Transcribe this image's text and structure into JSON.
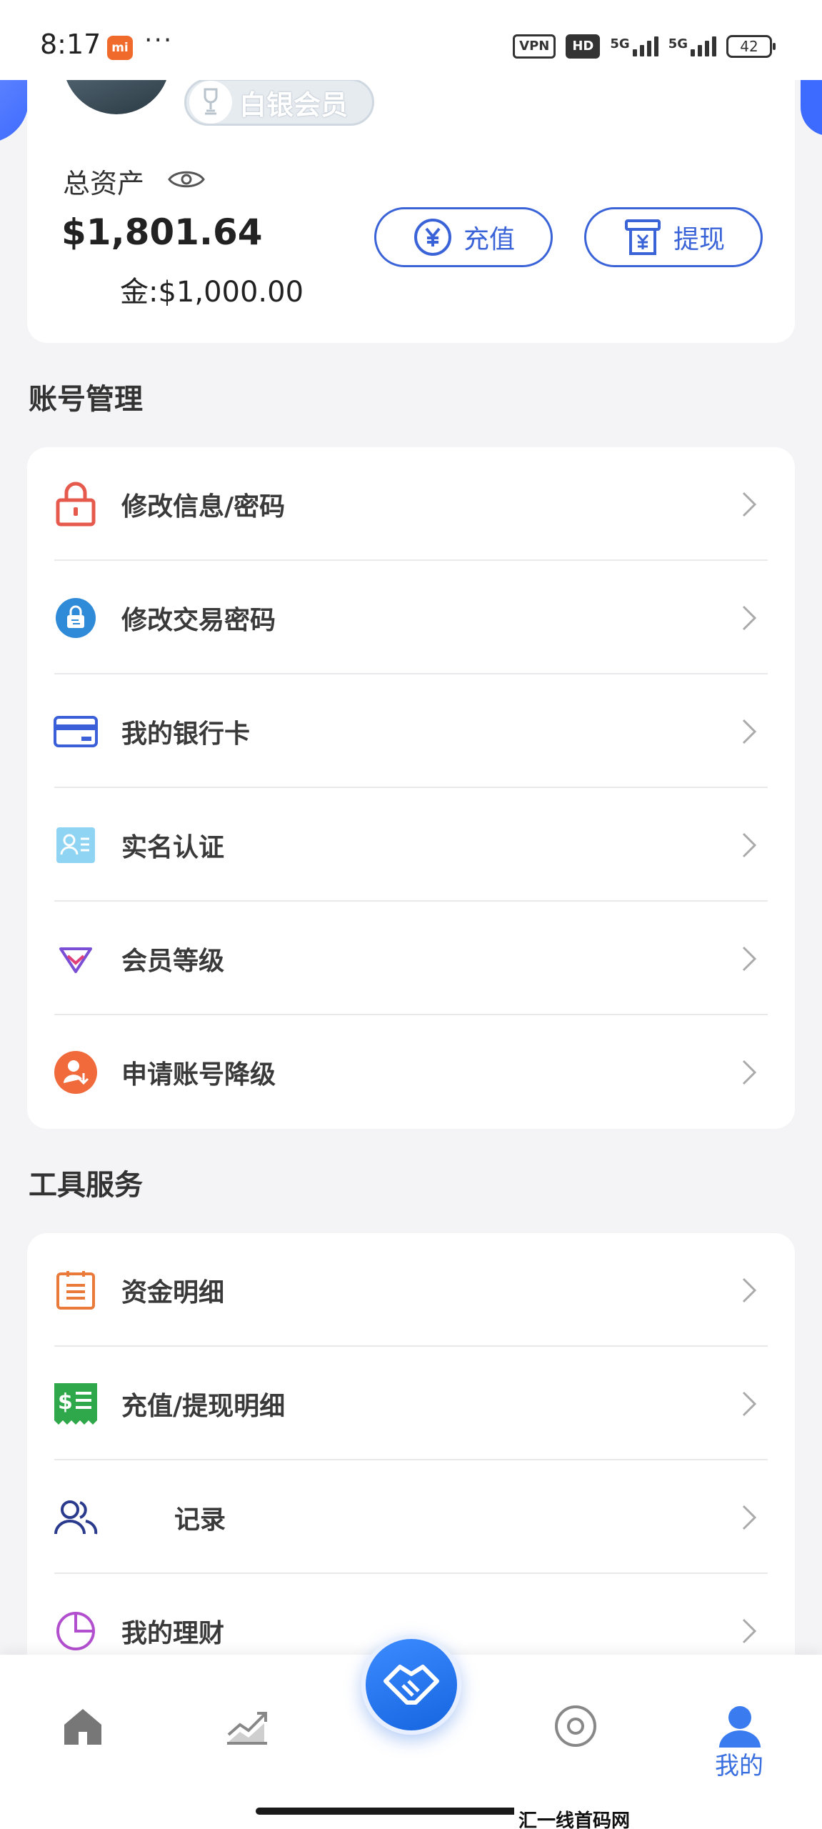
{
  "status_bar": {
    "time": "8:17",
    "app_badge": "mi",
    "more": "···",
    "vpn": "VPN",
    "hd": "HD",
    "network1": "5G",
    "network2": "5G",
    "battery": "42"
  },
  "profile": {
    "member_level": "白银会员",
    "total_assets_label": "总资产",
    "total_assets_value": "$1,801.64",
    "gold_value": "金:$1,000.00",
    "recharge_label": "充值",
    "withdraw_label": "提现"
  },
  "account_section": {
    "title": "账号管理",
    "items": [
      {
        "label": "修改信息/密码",
        "icon": "lock-icon"
      },
      {
        "label": "修改交易密码",
        "icon": "trade-lock-icon"
      },
      {
        "label": "我的银行卡",
        "icon": "bank-card-icon"
      },
      {
        "label": "实名认证",
        "icon": "id-card-icon"
      },
      {
        "label": "会员等级",
        "icon": "diamond-icon"
      },
      {
        "label": "申请账号降级",
        "icon": "user-down-icon"
      }
    ]
  },
  "tools_section": {
    "title": "工具服务",
    "items": [
      {
        "label": "资金明细",
        "icon": "ledger-icon"
      },
      {
        "label": "充值/提现明细",
        "icon": "receipt-icon"
      },
      {
        "label": "记录",
        "icon": "users-icon"
      },
      {
        "label": "我的理财",
        "icon": "pie-chart-icon"
      }
    ]
  },
  "tabbar": {
    "active_label": "我的"
  },
  "watermark": "汇一线首码网 www.huiyixian.com",
  "colors": {
    "accent": "#3a63d8",
    "tab_active": "#3a6fe0"
  }
}
